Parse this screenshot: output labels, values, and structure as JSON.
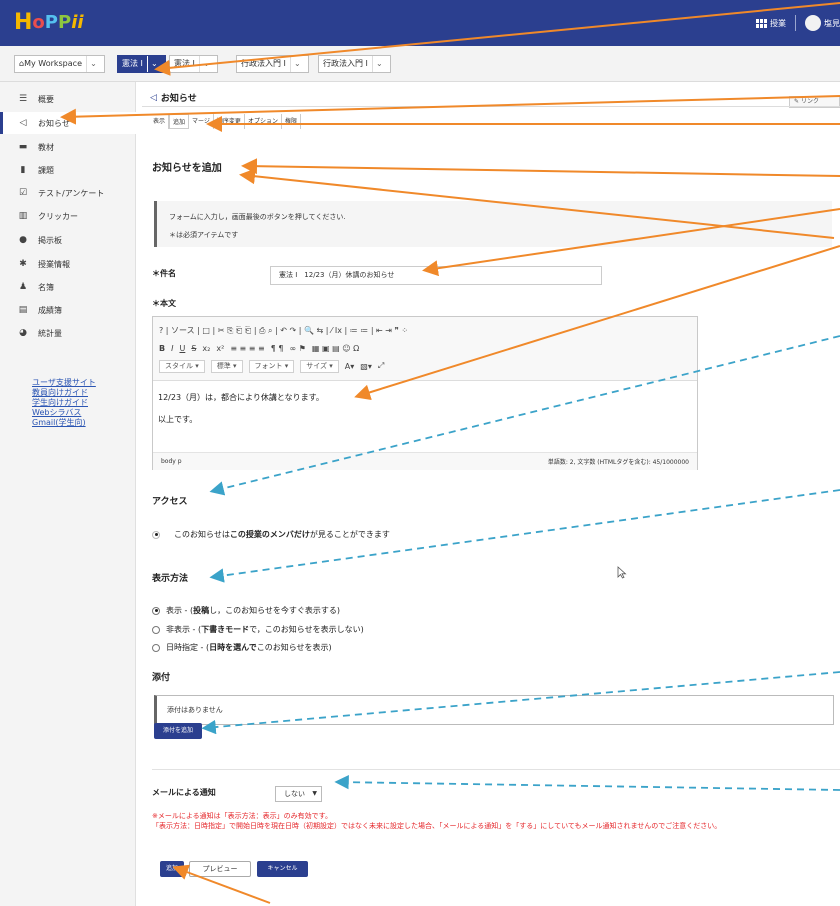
{
  "brand": {
    "logo_text": "HoPPii"
  },
  "topbar": {
    "jugyo_label": "授業",
    "user_name": "塩見"
  },
  "site_tabs": [
    {
      "label": "My Workspace",
      "active": false
    },
    {
      "label": "憲法 I",
      "active": true
    },
    {
      "label": "憲法 I",
      "active": false
    },
    {
      "label": "行政法入門 I",
      "active": false
    },
    {
      "label": "行政法入門 I",
      "active": false
    }
  ],
  "sidebar": {
    "items": [
      {
        "icon": "list-icon",
        "label": "概要"
      },
      {
        "icon": "megaphone-icon",
        "label": "お知らせ"
      },
      {
        "icon": "folder-icon",
        "label": "教材"
      },
      {
        "icon": "document-icon",
        "label": "課題"
      },
      {
        "icon": "checkbox-icon",
        "label": "テスト/アンケート"
      },
      {
        "icon": "bar-chart-icon",
        "label": "クリッカー"
      },
      {
        "icon": "chat-icon",
        "label": "掲示板"
      },
      {
        "icon": "gear-icon",
        "label": "授業情報"
      },
      {
        "icon": "people-icon",
        "label": "名簿"
      },
      {
        "icon": "book-icon",
        "label": "成績簿"
      },
      {
        "icon": "pie-chart-icon",
        "label": "統計量"
      }
    ],
    "links": [
      "ユーザ支援サイト",
      "教員向けガイド",
      "学生向けガイド",
      "Webシラバス",
      "Gmail(学生向)"
    ]
  },
  "page": {
    "tool_title": "お知らせ",
    "link_button": "リンク",
    "subnav": [
      "表示",
      "追加",
      "マージ",
      "順序変更",
      "オプション",
      "権限"
    ],
    "form_title": "お知らせを追加",
    "instructions": [
      "フォームに入力し，画面最後のボタンを押してください.",
      "＊は必須アイテムです"
    ],
    "subject_label": "＊件名",
    "subject_value": "憲法 I　12/23（月）休講のお知らせ",
    "body_label": "＊本文",
    "editor": {
      "toolbar_row1": "? | ソース | □ | ✂ ⎘ ⎗ ⎗ | ⎙ ⌕ | ↶ ↷ | 🔍 ⇆ | ⁄ Ix | ≔ ≔ | ⇤ ⇥ ❞ ⁘",
      "toolbar_row3_style": "スタイル",
      "toolbar_row3_format": "標準",
      "toolbar_row3_font": "フォント",
      "toolbar_row3_size": "サイズ",
      "body_line1": "12/23（月）は，都合により休講となります。",
      "body_line2": "以上です。",
      "status_path": "body  p",
      "word_count": "単語数: 2, 文字数 (HTMLタグを含む): 45/1000000"
    },
    "access_title": "アクセス",
    "access_option_pre": "このお知らせは",
    "access_option_bold": "この授業のメンバだけ",
    "access_option_post": "が見ることができます",
    "display_title": "表示方法",
    "display_options": [
      {
        "pre": "表示 - (",
        "bold": "投稿",
        "post": "し，このお知らせを今すぐ表示する)",
        "checked": true
      },
      {
        "pre": "非表示 - (",
        "bold": "下書きモード",
        "post": "で，このお知らせを表示しない)",
        "checked": false
      },
      {
        "pre": "日時指定 - (",
        "bold": "日時を選んで",
        "post": "このお知らせを表示)",
        "checked": false
      }
    ],
    "attach_title": "添付",
    "attach_empty": "添付はありません",
    "attach_button": "添付を追加",
    "mail_label": "メールによる通知",
    "mail_value": "しない",
    "note_line1": "※メールによる通知は「表示方法：表示」のみ有効です。",
    "note_line2": "「表示方法：日時指定」で開始日時を現在日時（初期設定）ではなく未来に設定した場合、「メールによる通知」を「する」にしていてもメール通知されませんのでご注意ください。",
    "buttons": {
      "add": "追加",
      "preview": "プレビュー",
      "cancel": "キャンセル"
    }
  },
  "colors": {
    "header": "#2b3f8f",
    "arrow_orange": "#f0892a",
    "arrow_blue": "#3ba3c9",
    "note_red": "#e5262a"
  }
}
